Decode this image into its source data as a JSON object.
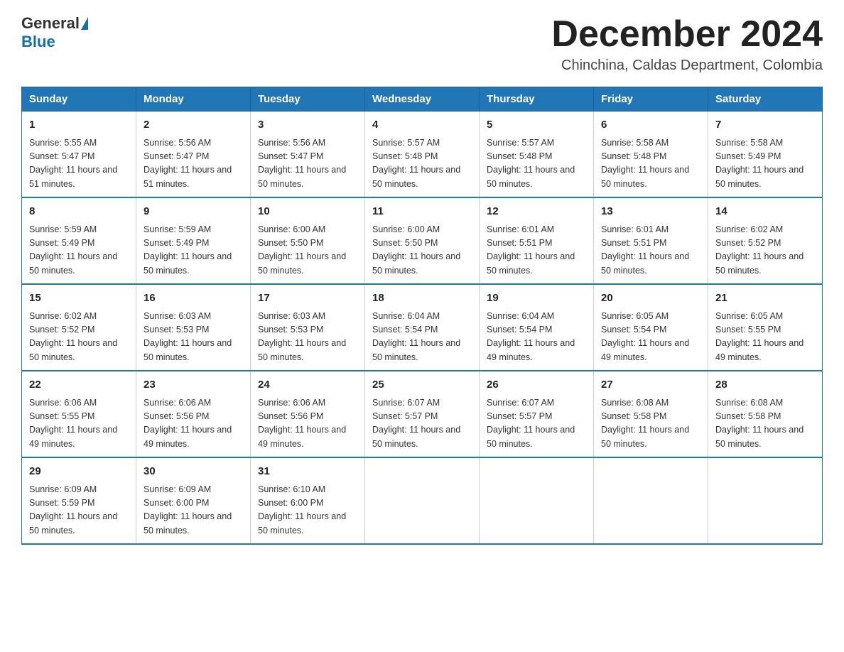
{
  "header": {
    "logo_general": "General",
    "logo_blue": "Blue",
    "month_title": "December 2024",
    "location": "Chinchina, Caldas Department, Colombia"
  },
  "weekdays": [
    "Sunday",
    "Monday",
    "Tuesday",
    "Wednesday",
    "Thursday",
    "Friday",
    "Saturday"
  ],
  "weeks": [
    [
      {
        "day": "1",
        "sunrise": "5:55 AM",
        "sunset": "5:47 PM",
        "daylight": "11 hours and 51 minutes."
      },
      {
        "day": "2",
        "sunrise": "5:56 AM",
        "sunset": "5:47 PM",
        "daylight": "11 hours and 51 minutes."
      },
      {
        "day": "3",
        "sunrise": "5:56 AM",
        "sunset": "5:47 PM",
        "daylight": "11 hours and 50 minutes."
      },
      {
        "day": "4",
        "sunrise": "5:57 AM",
        "sunset": "5:48 PM",
        "daylight": "11 hours and 50 minutes."
      },
      {
        "day": "5",
        "sunrise": "5:57 AM",
        "sunset": "5:48 PM",
        "daylight": "11 hours and 50 minutes."
      },
      {
        "day": "6",
        "sunrise": "5:58 AM",
        "sunset": "5:48 PM",
        "daylight": "11 hours and 50 minutes."
      },
      {
        "day": "7",
        "sunrise": "5:58 AM",
        "sunset": "5:49 PM",
        "daylight": "11 hours and 50 minutes."
      }
    ],
    [
      {
        "day": "8",
        "sunrise": "5:59 AM",
        "sunset": "5:49 PM",
        "daylight": "11 hours and 50 minutes."
      },
      {
        "day": "9",
        "sunrise": "5:59 AM",
        "sunset": "5:49 PM",
        "daylight": "11 hours and 50 minutes."
      },
      {
        "day": "10",
        "sunrise": "6:00 AM",
        "sunset": "5:50 PM",
        "daylight": "11 hours and 50 minutes."
      },
      {
        "day": "11",
        "sunrise": "6:00 AM",
        "sunset": "5:50 PM",
        "daylight": "11 hours and 50 minutes."
      },
      {
        "day": "12",
        "sunrise": "6:01 AM",
        "sunset": "5:51 PM",
        "daylight": "11 hours and 50 minutes."
      },
      {
        "day": "13",
        "sunrise": "6:01 AM",
        "sunset": "5:51 PM",
        "daylight": "11 hours and 50 minutes."
      },
      {
        "day": "14",
        "sunrise": "6:02 AM",
        "sunset": "5:52 PM",
        "daylight": "11 hours and 50 minutes."
      }
    ],
    [
      {
        "day": "15",
        "sunrise": "6:02 AM",
        "sunset": "5:52 PM",
        "daylight": "11 hours and 50 minutes."
      },
      {
        "day": "16",
        "sunrise": "6:03 AM",
        "sunset": "5:53 PM",
        "daylight": "11 hours and 50 minutes."
      },
      {
        "day": "17",
        "sunrise": "6:03 AM",
        "sunset": "5:53 PM",
        "daylight": "11 hours and 50 minutes."
      },
      {
        "day": "18",
        "sunrise": "6:04 AM",
        "sunset": "5:54 PM",
        "daylight": "11 hours and 50 minutes."
      },
      {
        "day": "19",
        "sunrise": "6:04 AM",
        "sunset": "5:54 PM",
        "daylight": "11 hours and 49 minutes."
      },
      {
        "day": "20",
        "sunrise": "6:05 AM",
        "sunset": "5:54 PM",
        "daylight": "11 hours and 49 minutes."
      },
      {
        "day": "21",
        "sunrise": "6:05 AM",
        "sunset": "5:55 PM",
        "daylight": "11 hours and 49 minutes."
      }
    ],
    [
      {
        "day": "22",
        "sunrise": "6:06 AM",
        "sunset": "5:55 PM",
        "daylight": "11 hours and 49 minutes."
      },
      {
        "day": "23",
        "sunrise": "6:06 AM",
        "sunset": "5:56 PM",
        "daylight": "11 hours and 49 minutes."
      },
      {
        "day": "24",
        "sunrise": "6:06 AM",
        "sunset": "5:56 PM",
        "daylight": "11 hours and 49 minutes."
      },
      {
        "day": "25",
        "sunrise": "6:07 AM",
        "sunset": "5:57 PM",
        "daylight": "11 hours and 50 minutes."
      },
      {
        "day": "26",
        "sunrise": "6:07 AM",
        "sunset": "5:57 PM",
        "daylight": "11 hours and 50 minutes."
      },
      {
        "day": "27",
        "sunrise": "6:08 AM",
        "sunset": "5:58 PM",
        "daylight": "11 hours and 50 minutes."
      },
      {
        "day": "28",
        "sunrise": "6:08 AM",
        "sunset": "5:58 PM",
        "daylight": "11 hours and 50 minutes."
      }
    ],
    [
      {
        "day": "29",
        "sunrise": "6:09 AM",
        "sunset": "5:59 PM",
        "daylight": "11 hours and 50 minutes."
      },
      {
        "day": "30",
        "sunrise": "6:09 AM",
        "sunset": "6:00 PM",
        "daylight": "11 hours and 50 minutes."
      },
      {
        "day": "31",
        "sunrise": "6:10 AM",
        "sunset": "6:00 PM",
        "daylight": "11 hours and 50 minutes."
      },
      null,
      null,
      null,
      null
    ]
  ],
  "labels": {
    "sunrise": "Sunrise:",
    "sunset": "Sunset:",
    "daylight": "Daylight:"
  }
}
